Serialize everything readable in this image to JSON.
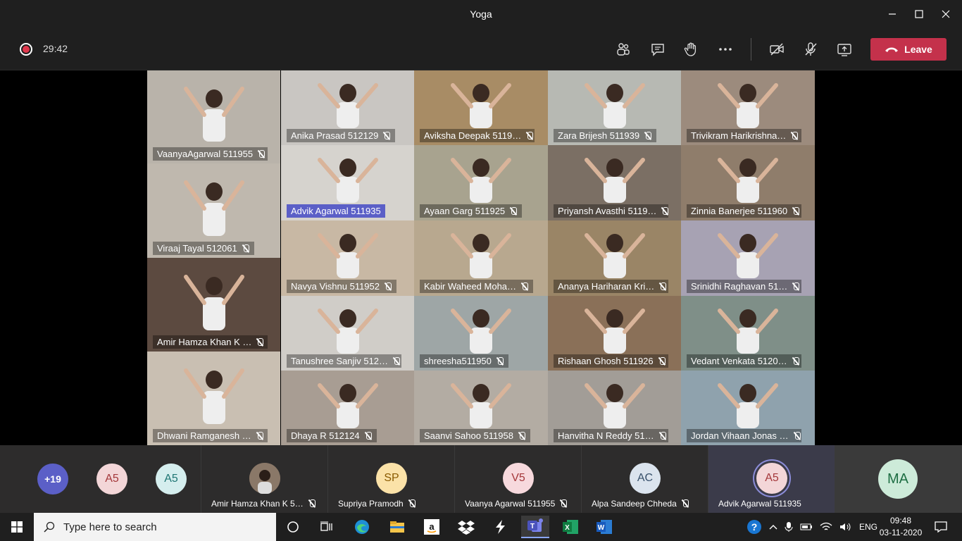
{
  "window": {
    "title": "Yoga",
    "controls": [
      "minimize-icon",
      "maximize-icon",
      "close-icon"
    ]
  },
  "toolbar": {
    "timer": "29:42",
    "leave_label": "Leave",
    "icons": [
      "participants-icon",
      "chat-icon",
      "raise-hand-icon",
      "more-icon",
      "camera-off-icon",
      "mic-off-icon",
      "share-screen-icon"
    ]
  },
  "grid": {
    "tiles": [
      {
        "label": "VaanyaAgarwal 511955",
        "bg": "#b9b3aa"
      },
      {
        "label": "Anika Prasad 512129",
        "bg": "#c9c6c2"
      },
      {
        "label": "Aviksha Deepak 5119…",
        "bg": "#a88c65"
      },
      {
        "label": "Zara Brijesh 511939",
        "bg": "#b7b9b3"
      },
      {
        "label": "Trivikram Harikrishna…",
        "bg": "#9c8b7d"
      },
      {
        "label": "Advik Agarwal 511935",
        "bg": "#d6d3ce",
        "active": true
      },
      {
        "label": "Ayaan Garg 511925",
        "bg": "#a8a38f"
      },
      {
        "label": "Priyansh Avasthi 5119…",
        "bg": "#7b6f64"
      },
      {
        "label": "Zinnia Banerjee 511960",
        "bg": "#8f7d6b"
      },
      {
        "label": "Viraaj Tayal 512061",
        "bg": "#bfb8ae"
      },
      {
        "label": "Navya Vishnu 511952",
        "bg": "#c8b8a4"
      },
      {
        "label": "Kabir Waheed Moha…",
        "bg": "#b8a88f"
      },
      {
        "label": "Ananya Hariharan Kri…",
        "bg": "#9a8566"
      },
      {
        "label": "Srinidhi Raghavan 51…",
        "bg": "#a7a2b3"
      },
      {
        "label": "Amir Hamza Khan K …",
        "bg": "#5c4a40"
      },
      {
        "label": "Tanushree Sanjiv 512…",
        "bg": "#d0cdc8"
      },
      {
        "label": "shreesha511950",
        "bg": "#9ea6a6"
      },
      {
        "label": "Rishaan Ghosh 511926",
        "bg": "#8a7058"
      },
      {
        "label": "Vedant Venkata 5120…",
        "bg": "#7f8f88"
      },
      {
        "label": "Dhwani Ramganesh …",
        "bg": "#c9bfb2"
      },
      {
        "label": "Dhaya R 512124",
        "bg": "#a89d93"
      },
      {
        "label": "Saanvi Sahoo 511958",
        "bg": "#b3aca3"
      },
      {
        "label": "Hanvitha N Reddy 51…",
        "bg": "#a29d97"
      },
      {
        "label": "Jordan Vihaan Jonas …",
        "bg": "#8fa2ad"
      }
    ]
  },
  "strip": {
    "overflow": {
      "label": "+19",
      "color": "#5b5fc7"
    },
    "avatars": [
      {
        "initials": "A5",
        "bg": "#f3d6d8",
        "fg": "#a4373a"
      },
      {
        "initials": "A5",
        "bg": "#d5eeee",
        "fg": "#1e7573"
      }
    ],
    "participants": [
      {
        "name": "Amir Hamza Khan K 5…",
        "initials": "",
        "bg": "#7a6458",
        "fg": "#fff",
        "photo": true
      },
      {
        "name": "Supriya Pramodh",
        "initials": "SP",
        "bg": "#fbe2a8",
        "fg": "#8a5a00"
      },
      {
        "name": "Vaanya Agarwal 511955",
        "initials": "V5",
        "bg": "#f7d9dd",
        "fg": "#a4373a"
      },
      {
        "name": "Alpa Sandeep Chheda",
        "initials": "AC",
        "bg": "#dbe4ee",
        "fg": "#37506b"
      },
      {
        "name": "Advik Agarwal 511935",
        "initials": "A5",
        "bg": "#f3d6d8",
        "fg": "#a4373a",
        "speaking": true
      }
    ],
    "self": {
      "initials": "MA",
      "bg": "#cdebd9",
      "fg": "#1e6e43"
    }
  },
  "taskbar": {
    "search_placeholder": "Type here to search",
    "apps": [
      "cortana-icon",
      "task-view-icon",
      "edge-icon",
      "file-explorer-icon",
      "amazon-icon",
      "dropbox-icon",
      "app-icon",
      "teams-icon",
      "excel-icon",
      "word-icon"
    ],
    "language": "ENG",
    "time": "09:48",
    "date": "03-11-2020"
  }
}
